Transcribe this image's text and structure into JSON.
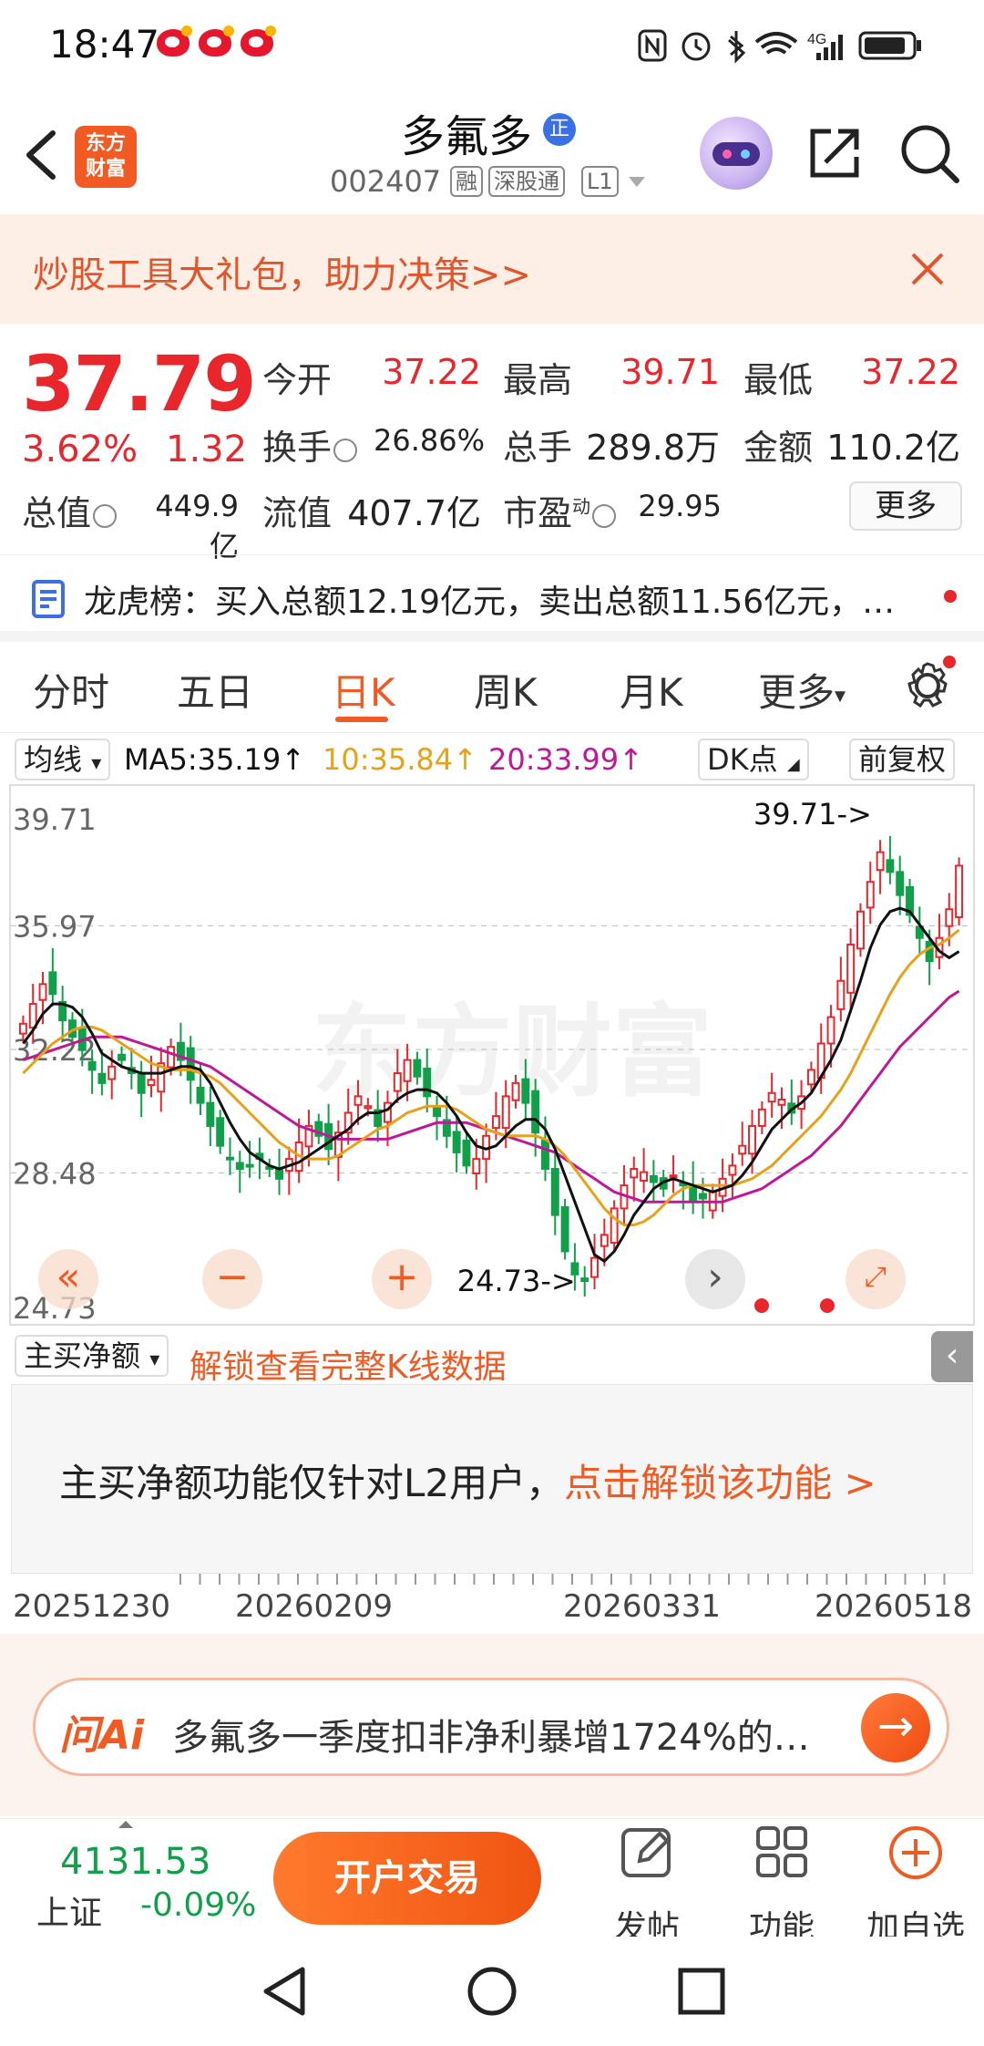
{
  "status": {
    "time": "18:47",
    "network": "4G"
  },
  "header": {
    "logo_text_1": "东方",
    "logo_text_2": "财富",
    "stock_name": "多氟多",
    "badge": "正",
    "code": "002407",
    "tags": [
      "融",
      "深股通",
      "L1"
    ]
  },
  "promo": {
    "text": "炒股工具大礼包，助力决策>>"
  },
  "quote": {
    "price": "37.79",
    "change_pct": "3.62%",
    "change": "1.32",
    "open_label": "今开",
    "open": "37.22",
    "high_label": "最高",
    "high": "39.71",
    "low_label": "最低",
    "low": "37.22",
    "turnover_label": "换手",
    "turnover": "26.86%",
    "volume_label": "总手",
    "volume": "289.8万",
    "amount_label": "金额",
    "amount": "110.2亿",
    "mktcap_label": "总值",
    "mktcap": "449.9亿",
    "float_label": "流值",
    "float": "407.7亿",
    "pe_label": "市盈",
    "pe_sup": "动",
    "pe": "29.95",
    "more_label": "更多"
  },
  "dragon": {
    "text": "龙虎榜：买入总额12.19亿元，卖出总额11.56亿元，…"
  },
  "tabs": [
    "分时",
    "五日",
    "日K",
    "周K",
    "月K",
    "更多"
  ],
  "ma": {
    "selector": "均线",
    "ma5": "MA5:35.19↑",
    "ma10": "10:35.84↑",
    "ma20": "20:33.99↑",
    "dk": "DK点",
    "adjust": "前复权",
    "colors": {
      "ma5": "#111111",
      "ma10": "#e8a21a",
      "ma20": "#c0179a"
    }
  },
  "chart_data": {
    "type": "candlestick",
    "y_ticks": [
      "39.71",
      "35.97",
      "32.22",
      "28.48",
      "24.73"
    ],
    "ylim": [
      24.73,
      39.71
    ],
    "max_marker": "39.71->",
    "min_marker": "24.73->",
    "watermark": "东方财富",
    "x_labels": [
      "20251230",
      "20260209",
      "20260331",
      "20260518"
    ],
    "up_color": "#e8262b",
    "down_color": "#11a04a",
    "closes": [
      33.0,
      33.6,
      34.2,
      33.9,
      33.1,
      32.6,
      32.2,
      31.6,
      31.2,
      31.7,
      31.9,
      31.5,
      30.9,
      31.3,
      31.8,
      32.3,
      31.9,
      31.3,
      30.6,
      29.9,
      29.3,
      28.9,
      28.6,
      28.7,
      28.9,
      28.6,
      28.3,
      28.9,
      29.4,
      29.9,
      29.6,
      29.2,
      29.7,
      30.3,
      30.8,
      30.5,
      29.9,
      30.6,
      31.5,
      31.9,
      31.4,
      30.8,
      30.2,
      29.6,
      29.1,
      28.7,
      28.9,
      29.6,
      30.2,
      30.8,
      31.2,
      30.6,
      29.7,
      28.6,
      27.2,
      26.1,
      25.4,
      25.2,
      25.9,
      26.6,
      27.4,
      28.1,
      28.6,
      28.5,
      28.2,
      28.0,
      28.4,
      28.1,
      27.6,
      27.7,
      27.9,
      28.3,
      28.7,
      29.3,
      29.9,
      30.4,
      30.9,
      30.7,
      30.3,
      30.8,
      31.6,
      32.4,
      33.2,
      34.3,
      35.4,
      36.4,
      37.3,
      38.2,
      37.6,
      36.9,
      36.3,
      35.6,
      34.9,
      35.6,
      36.47,
      37.79
    ],
    "ma5": [
      32.4,
      32.8,
      33.3,
      33.6,
      33.6,
      33.5,
      33.2,
      32.7,
      32.1,
      31.9,
      31.7,
      31.6,
      31.5,
      31.5,
      31.5,
      31.6,
      31.7,
      31.7,
      31.6,
      31.2,
      30.6,
      30.0,
      29.5,
      29.1,
      28.9,
      28.7,
      28.6,
      28.7,
      28.8,
      29.0,
      29.2,
      29.4,
      29.6,
      29.8,
      30.1,
      30.3,
      30.3,
      30.4,
      30.7,
      30.9,
      31.0,
      31.0,
      30.9,
      30.6,
      30.2,
      29.7,
      29.3,
      29.2,
      29.3,
      29.6,
      29.9,
      30.1,
      30.1,
      29.8,
      29.2,
      28.4,
      27.6,
      26.8,
      26.0,
      25.8,
      26.1,
      26.6,
      27.2,
      27.6,
      28.0,
      28.2,
      28.3,
      28.2,
      28.1,
      28.0,
      27.9,
      28.0,
      28.1,
      28.4,
      28.8,
      29.3,
      29.8,
      30.1,
      30.4,
      30.6,
      30.9,
      31.4,
      31.9,
      32.5,
      33.4,
      34.3,
      35.3,
      36.0,
      36.4,
      36.5,
      36.4,
      36.0,
      35.6,
      35.2,
      35.0,
      35.19
    ],
    "ma10": [
      31.5,
      31.8,
      32.1,
      32.4,
      32.6,
      32.8,
      32.9,
      32.9,
      32.8,
      32.6,
      32.4,
      32.2,
      32.0,
      31.8,
      31.7,
      31.6,
      31.6,
      31.6,
      31.5,
      31.4,
      31.2,
      30.9,
      30.6,
      30.3,
      30.0,
      29.7,
      29.4,
      29.2,
      29.0,
      28.9,
      28.9,
      28.9,
      29.0,
      29.2,
      29.4,
      29.6,
      29.8,
      29.9,
      30.1,
      30.3,
      30.4,
      30.5,
      30.5,
      30.5,
      30.4,
      30.2,
      30.0,
      29.8,
      29.7,
      29.6,
      29.6,
      29.6,
      29.6,
      29.5,
      29.3,
      29.0,
      28.6,
      28.2,
      27.8,
      27.4,
      27.1,
      26.9,
      26.9,
      27.0,
      27.2,
      27.5,
      27.8,
      28.0,
      28.1,
      28.1,
      28.1,
      28.1,
      28.1,
      28.2,
      28.3,
      28.5,
      28.7,
      29.0,
      29.3,
      29.6,
      29.9,
      30.2,
      30.6,
      31.0,
      31.5,
      32.1,
      32.7,
      33.3,
      33.9,
      34.4,
      34.8,
      35.1,
      35.3,
      35.4,
      35.6,
      35.84
    ],
    "ma20": [
      31.9,
      32.0,
      32.1,
      32.2,
      32.3,
      32.4,
      32.5,
      32.6,
      32.6,
      32.6,
      32.6,
      32.5,
      32.4,
      32.3,
      32.2,
      32.1,
      32.0,
      31.9,
      31.8,
      31.7,
      31.5,
      31.3,
      31.1,
      30.9,
      30.7,
      30.5,
      30.3,
      30.1,
      29.9,
      29.8,
      29.7,
      29.6,
      29.5,
      29.5,
      29.5,
      29.5,
      29.5,
      29.5,
      29.6,
      29.7,
      29.8,
      29.9,
      30.0,
      30.0,
      30.0,
      30.0,
      29.9,
      29.8,
      29.7,
      29.6,
      29.5,
      29.4,
      29.3,
      29.2,
      29.1,
      28.9,
      28.7,
      28.5,
      28.3,
      28.1,
      27.9,
      27.8,
      27.7,
      27.6,
      27.6,
      27.6,
      27.6,
      27.6,
      27.6,
      27.6,
      27.6,
      27.6,
      27.7,
      27.8,
      27.9,
      28.0,
      28.2,
      28.4,
      28.6,
      28.8,
      29.0,
      29.3,
      29.6,
      29.9,
      30.3,
      30.7,
      31.1,
      31.5,
      31.9,
      32.3,
      32.6,
      32.9,
      33.2,
      33.5,
      33.8,
      33.99
    ]
  },
  "net": {
    "selector": "主买净额",
    "unlock": "解锁查看完整K线数据",
    "panel_text": "主买净额功能仅针对L2用户，",
    "panel_link": "点击解锁该功能 >"
  },
  "ai": {
    "logo": "问Ai",
    "text": "多氟多一季度扣非净利暴增1724%的…"
  },
  "bottom": {
    "index_value": "4131.53",
    "index_name": "上证",
    "index_change": "-0.09%",
    "open_account": "开户交易",
    "post": "发帖",
    "function": "功能",
    "watchlist": "加自选"
  }
}
